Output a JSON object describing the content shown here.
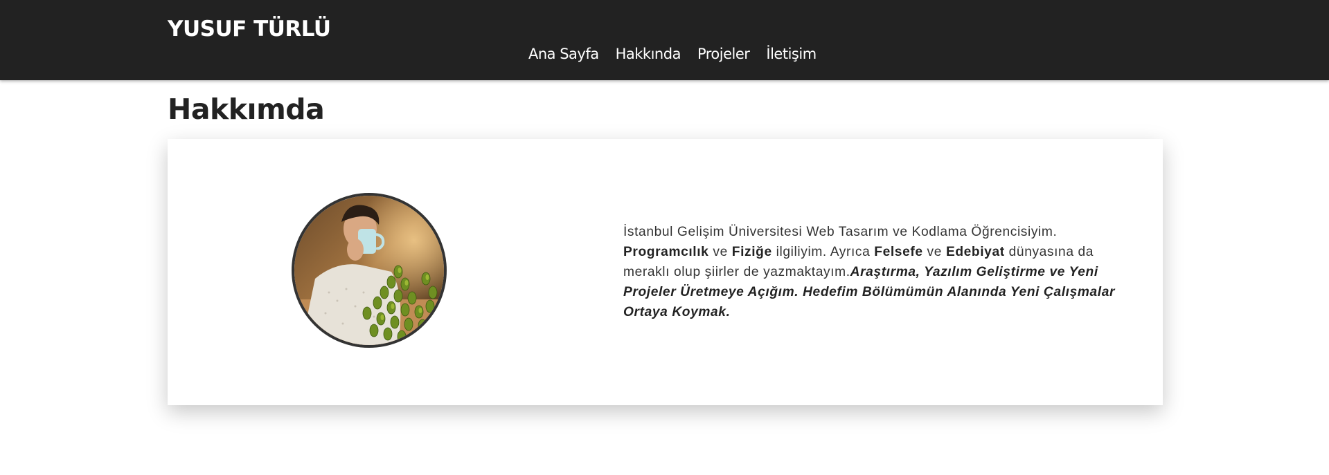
{
  "header": {
    "logo": "YUSUF TÜRLÜ",
    "nav": [
      {
        "label": "Ana Sayfa"
      },
      {
        "label": "Hakkında"
      },
      {
        "label": "Projeler"
      },
      {
        "label": "İletişim"
      }
    ]
  },
  "main": {
    "title": "Hakkımda",
    "bio": {
      "p1": "İstanbul Gelişim Üniversitesi Web Tasarım ve Kodlama Öğrencisiyim.",
      "b1": "Programcılık",
      "t1": " ve ",
      "b2": "Fiziğe",
      "t2": " ilgiliyim. Ayrıca ",
      "b3": "Felsefe",
      "t3": " ve ",
      "b4": "Edebiyat",
      "t4": " dünyasına da meraklı olup şiirler de yazmaktayım.",
      "emphasis": "Araştırma, Yazılım Geliştirme ve Yeni Projeler Üretmeye Açığım. Hedefim Bölümümün Alanında Yeni Çalışmalar Ortaya Koymak."
    }
  },
  "colors": {
    "header_bg": "#222222",
    "header_text": "#ffffff",
    "title_text": "#222222",
    "avatar_border": "#333333"
  }
}
